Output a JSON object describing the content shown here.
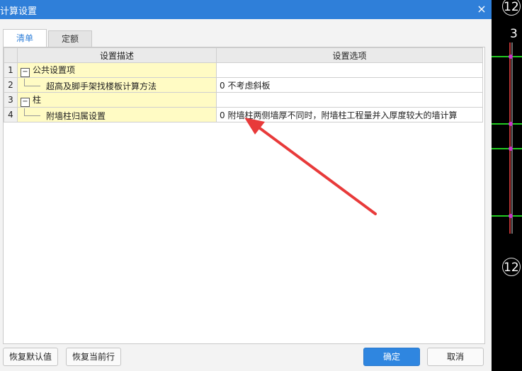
{
  "dialog": {
    "title": "计算设置",
    "close_glyph": "×"
  },
  "tabs": [
    {
      "label": "清单",
      "active": true
    },
    {
      "label": "定额",
      "active": false
    }
  ],
  "grid": {
    "columns": [
      "设置描述",
      "设置选项"
    ],
    "rows": [
      {
        "num": "1",
        "type": "group",
        "toggle": "−",
        "desc": "公共设置项",
        "option": ""
      },
      {
        "num": "2",
        "type": "child",
        "desc": "超高及脚手架找楼板计算方法",
        "option": "0 不考虑斜板"
      },
      {
        "num": "3",
        "type": "group",
        "toggle": "−",
        "desc": "柱",
        "option": ""
      },
      {
        "num": "4",
        "type": "child",
        "desc": "附墙柱归属设置",
        "option": "0 附墙柱两侧墙厚不同时，附墙柱工程量并入厚度较大的墙计算"
      }
    ]
  },
  "buttons": {
    "restore_default": "恢复默认值",
    "restore_current_row": "恢复当前行",
    "ok": "确定",
    "cancel": "取消"
  },
  "cad": {
    "labels": [
      "12",
      "3",
      "12"
    ]
  },
  "colors": {
    "titlebar": "#2f7fd9",
    "highlight_cell": "#fffbc4",
    "primary_button": "#2f86e0",
    "annotation_arrow": "#e83a3a"
  }
}
